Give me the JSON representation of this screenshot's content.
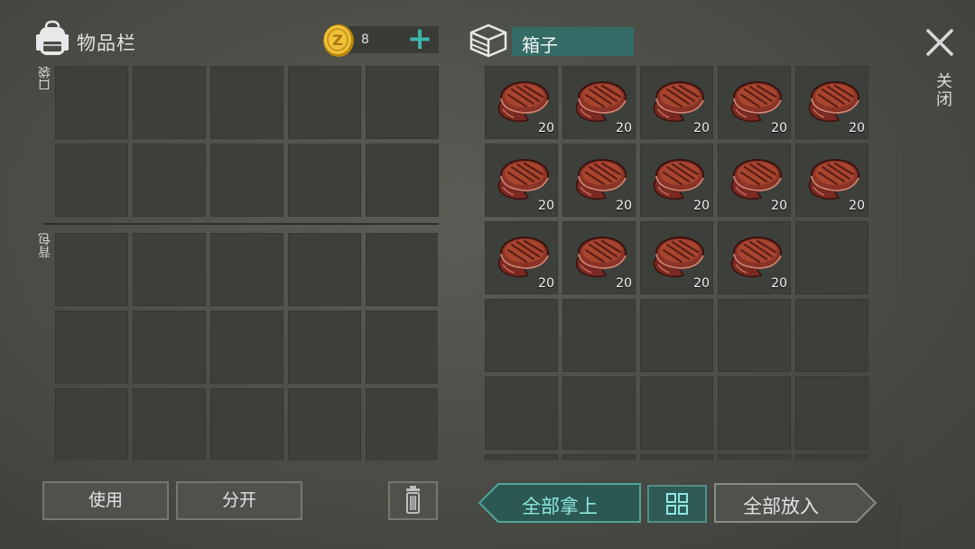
{
  "inventory": {
    "title": "物品栏",
    "coins": "8",
    "add_coin": "+",
    "pocket_label": "口袋",
    "backpack_label": "背包",
    "pocket_rows": 2,
    "backpack_rows": 3,
    "columns": 5
  },
  "container": {
    "title": "箱子",
    "columns": 5,
    "visible_rows": 6,
    "items": [
      {
        "icon": "steak-icon",
        "count": "20"
      },
      {
        "icon": "steak-icon",
        "count": "20"
      },
      {
        "icon": "steak-icon",
        "count": "20"
      },
      {
        "icon": "steak-icon",
        "count": "20"
      },
      {
        "icon": "steak-icon",
        "count": "20"
      },
      {
        "icon": "steak-icon",
        "count": "20"
      },
      {
        "icon": "steak-icon",
        "count": "20"
      },
      {
        "icon": "steak-icon",
        "count": "20"
      },
      {
        "icon": "steak-icon",
        "count": "20"
      },
      {
        "icon": "steak-icon",
        "count": "20"
      },
      {
        "icon": "steak-icon",
        "count": "20"
      },
      {
        "icon": "steak-icon",
        "count": "20"
      },
      {
        "icon": "steak-icon",
        "count": "20"
      },
      {
        "icon": "steak-icon",
        "count": "20"
      }
    ]
  },
  "sidebar": {
    "close_label": "关闭"
  },
  "actions": {
    "use": "使用",
    "split": "分开",
    "take_all": "全部拿上",
    "put_all": "全部放入"
  },
  "colors": {
    "accent": "#3fb6ad",
    "accent_dark": "#356b66",
    "slot": "#3d3f3b",
    "background": "#4a4c46"
  }
}
